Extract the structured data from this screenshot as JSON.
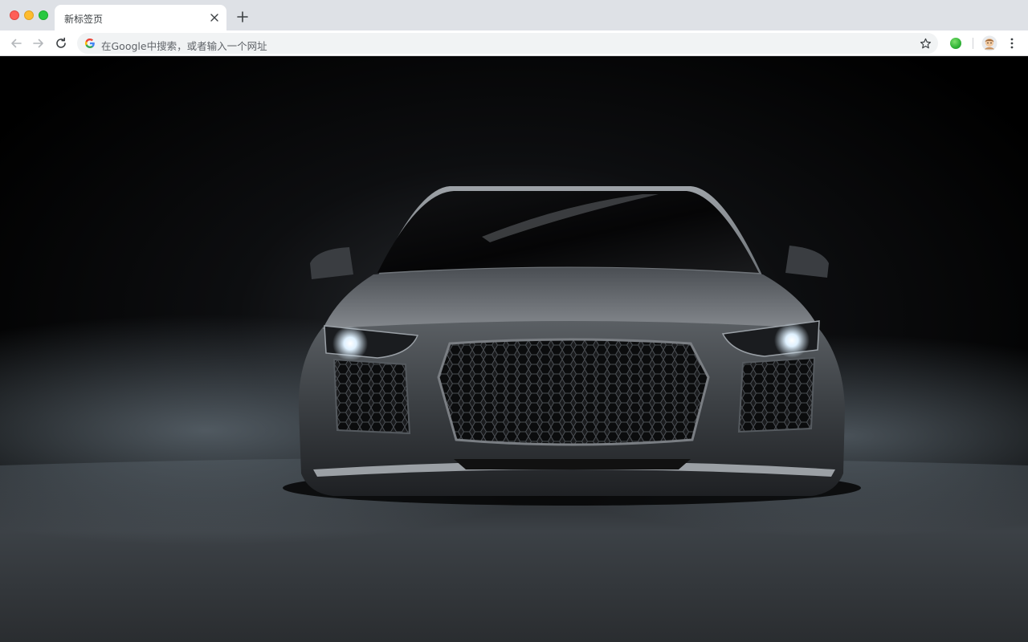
{
  "window": {
    "controls": {
      "close_color": "#ff5f57",
      "minimize_color": "#febc2e",
      "maximize_color": "#28c840"
    }
  },
  "tabs": [
    {
      "title": "新标签页",
      "active": true,
      "close_icon": "close-icon"
    }
  ],
  "new_tab_icon": "plus-icon",
  "toolbar": {
    "back_icon": "arrow-left-icon",
    "forward_icon": "arrow-right-icon",
    "reload_icon": "reload-icon",
    "omnibox": {
      "provider_icon": "google-g-icon",
      "placeholder": "在Google中搜索，或者输入一个网址"
    },
    "bookmark_icon": "star-icon",
    "extension_icon": "green-circle-extension-icon",
    "profile_icon": "avatar-icon",
    "menu_icon": "kebab-menu-icon"
  },
  "page": {
    "wallpaper": "dark-studio-sports-car-front-view",
    "colors": {
      "background": "#000000",
      "car_body": "#5a5e63",
      "headlight": "#e8f4ff",
      "smoke": "#8a9aa6"
    }
  }
}
